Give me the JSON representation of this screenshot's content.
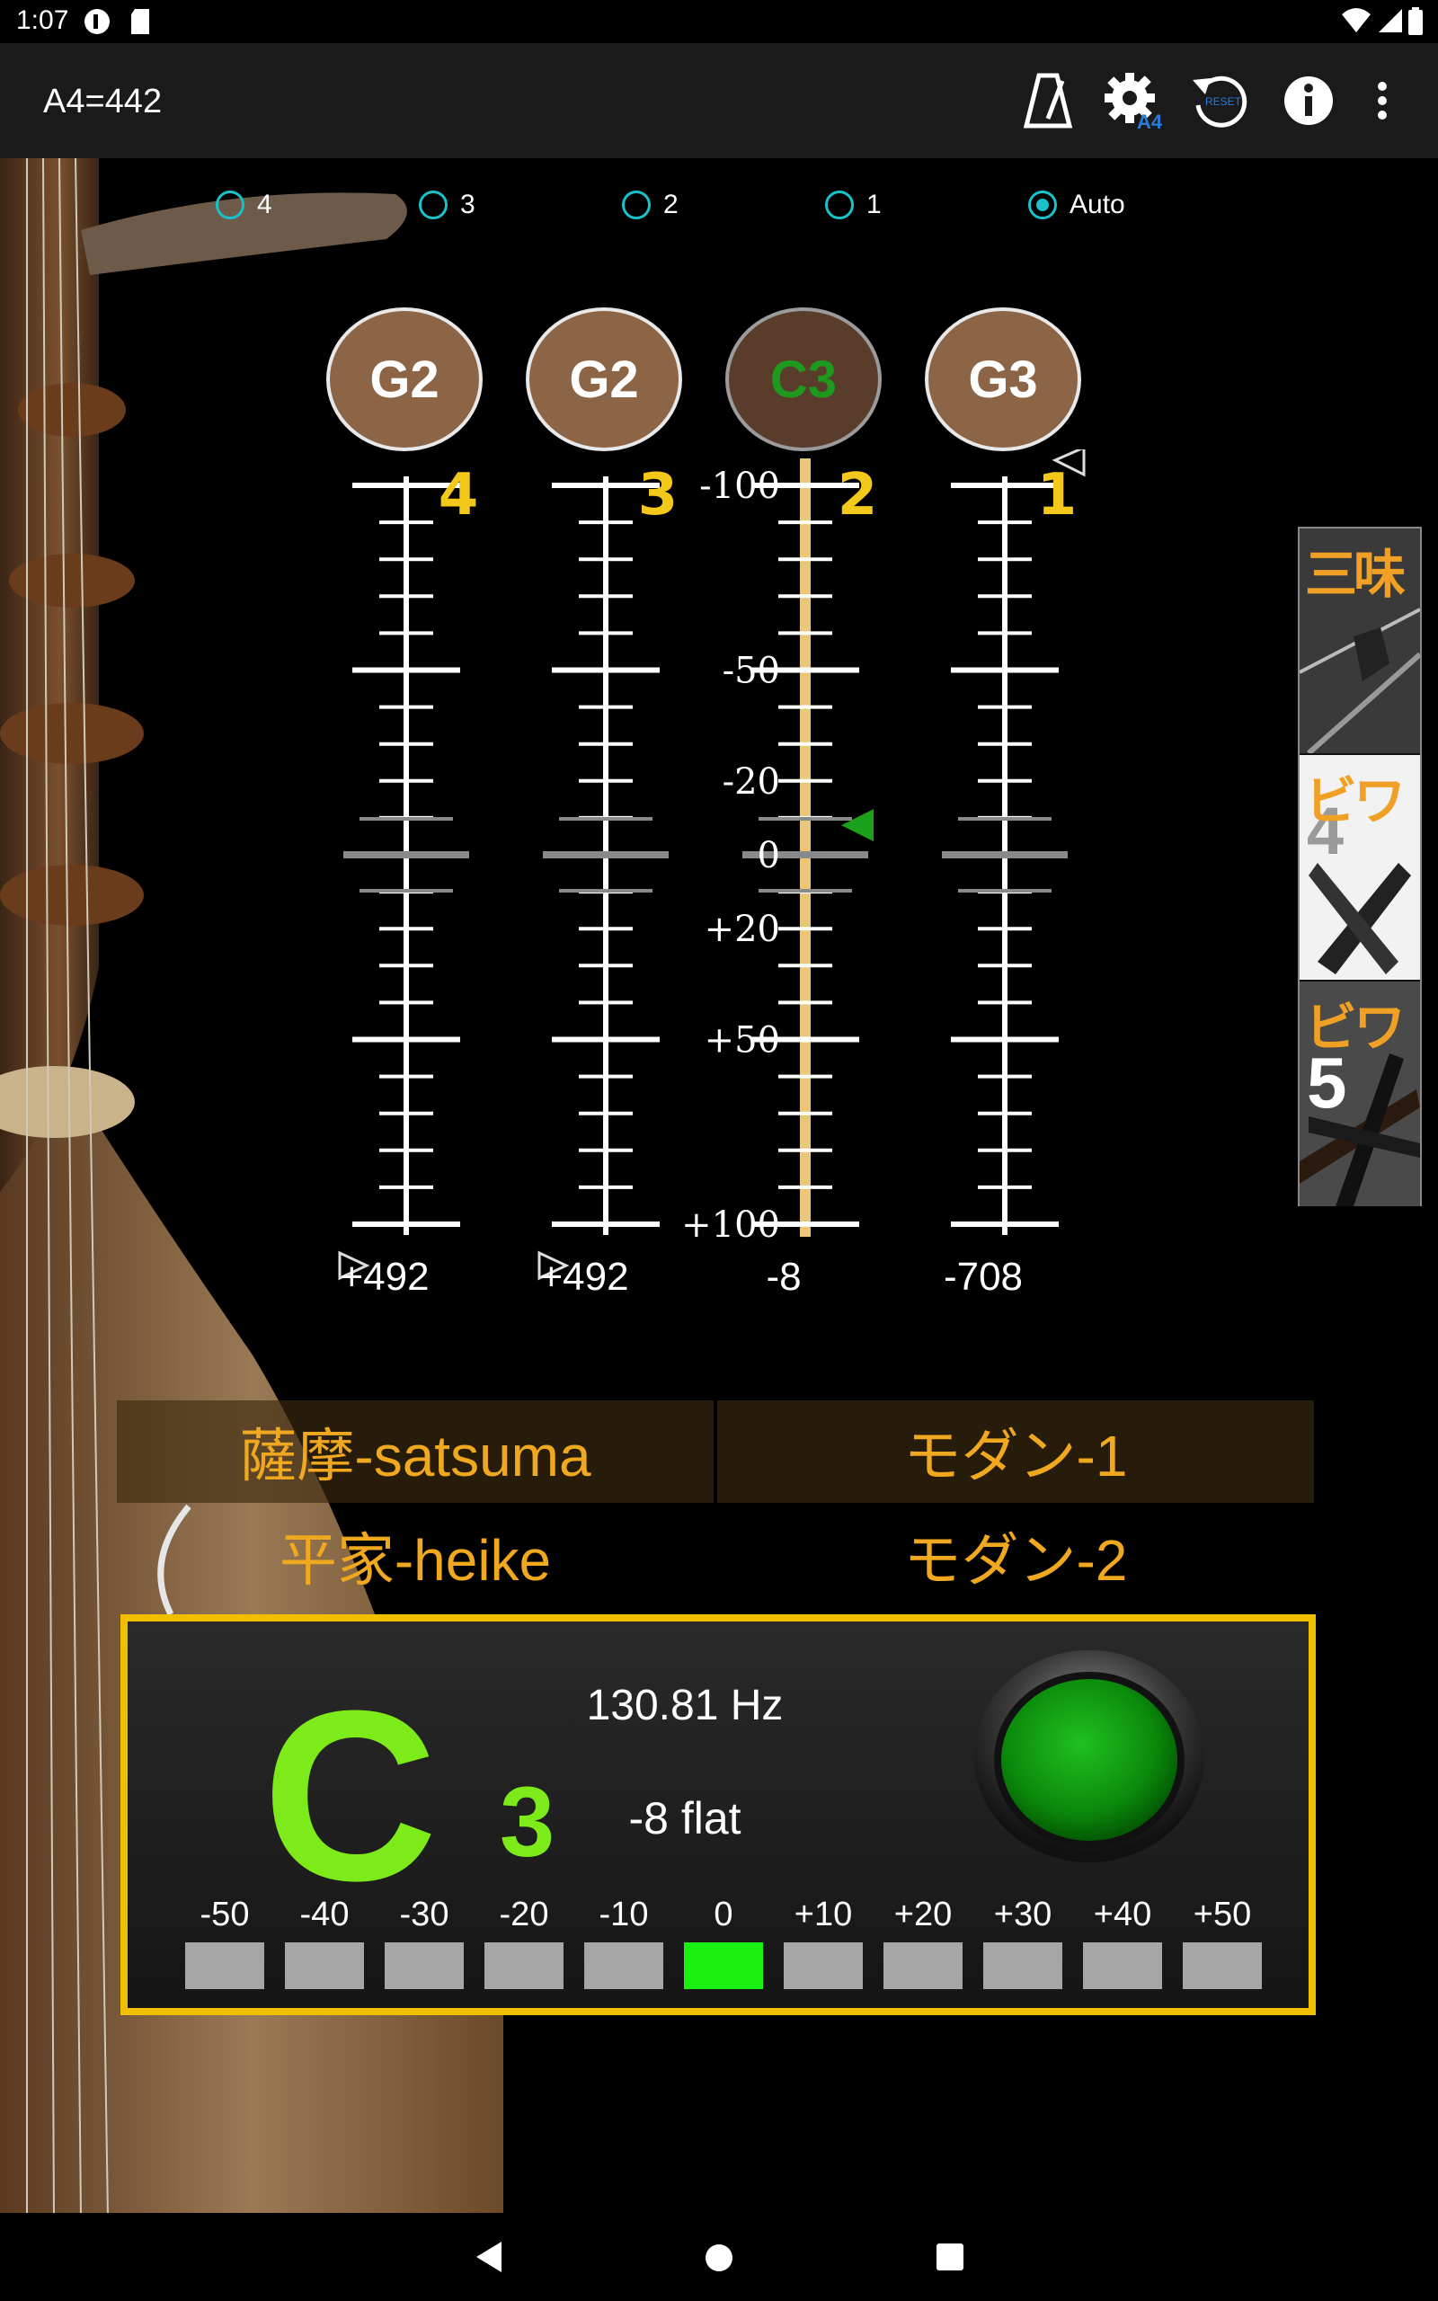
{
  "status_bar": {
    "time": "1:07"
  },
  "app_bar": {
    "title": "A4=442"
  },
  "strings_radio": [
    {
      "label": "4",
      "selected": false
    },
    {
      "label": "3",
      "selected": false
    },
    {
      "label": "2",
      "selected": false
    },
    {
      "label": "1",
      "selected": false
    },
    {
      "label": "Auto",
      "selected": true
    }
  ],
  "notes": [
    {
      "label": "G2",
      "active": false
    },
    {
      "label": "G2",
      "active": false
    },
    {
      "label": "C3",
      "active": true
    },
    {
      "label": "G3",
      "active": false
    }
  ],
  "meters": {
    "string_numbers": [
      "4",
      "3",
      "2",
      "1"
    ],
    "scale_labels": [
      "-100",
      "-50",
      "-20",
      "0",
      "+20",
      "+50",
      "+100"
    ],
    "cent_readouts": [
      "+492",
      "+492",
      "-8",
      "-708"
    ]
  },
  "side_tabs": [
    {
      "label": "三味"
    },
    {
      "label": "ビワ",
      "number": "4"
    },
    {
      "label": "ビワ",
      "number": "5"
    }
  ],
  "tunings": {
    "satsuma": "薩摩-satsuma",
    "modern1": "モダン-1",
    "heike": "平家-heike",
    "modern2": "モダン-2"
  },
  "display": {
    "note_letter": "C",
    "note_octave": "3",
    "frequency": "130.81 Hz",
    "deviation": "-8 flat",
    "segment_labels": [
      "-50",
      "-40",
      "-30",
      "-20",
      "-10",
      "0",
      "+10",
      "+20",
      "+30",
      "+40",
      "+50"
    ],
    "active_segment_index": 5
  },
  "colors": {
    "accent_orange": "#f0a81e",
    "in_tune_green": "#19f010",
    "radio_teal": "#19c1c8",
    "panel_border": "#f0c000"
  }
}
